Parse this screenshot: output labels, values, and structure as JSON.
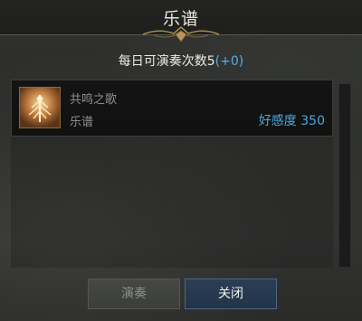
{
  "window": {
    "title": "乐谱"
  },
  "daily_plays": {
    "label": "每日可演奏次数5",
    "bonus": "(+0)"
  },
  "scores": [
    {
      "name": "共鸣之歌",
      "type": "乐谱",
      "favor_label": "好感度",
      "favor_value": "350",
      "icon": "song-of-resonance-icon"
    }
  ],
  "buttons": {
    "play_label": "演奏",
    "close_label": "关闭"
  }
}
